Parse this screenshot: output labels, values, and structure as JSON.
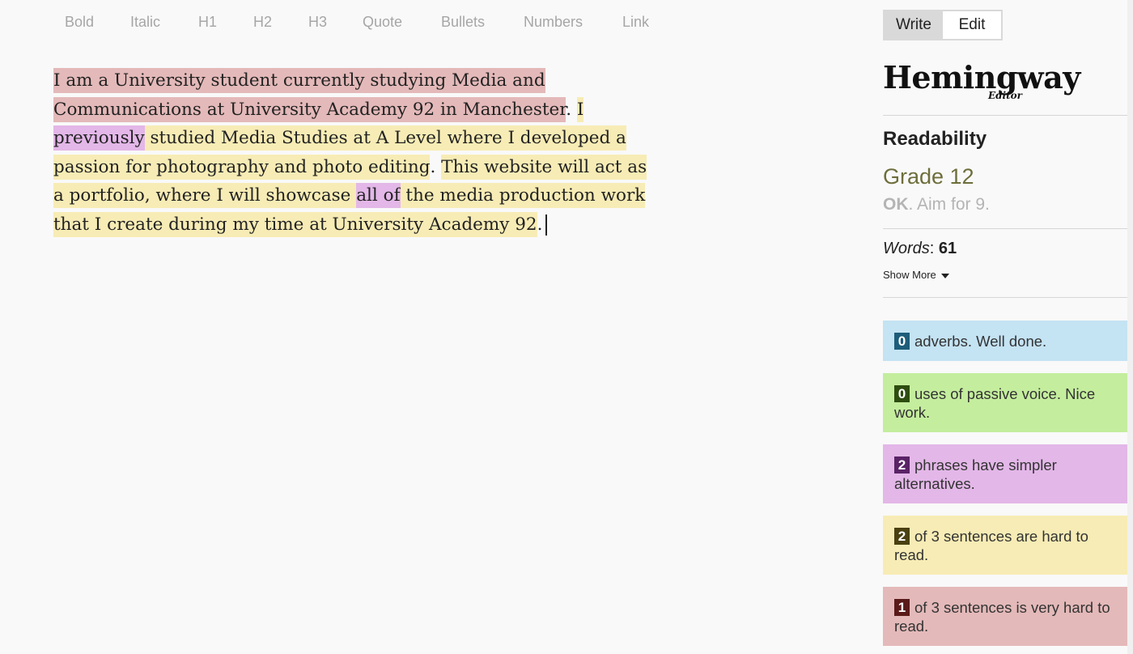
{
  "toolbar": {
    "bold": "Bold",
    "italic": "Italic",
    "h1": "H1",
    "h2": "H2",
    "h3": "H3",
    "quote": "Quote",
    "bullets": "Bullets",
    "numbers": "Numbers",
    "link": "Link"
  },
  "editor": {
    "line1": {
      "vhard": " I am a University student currently studying Media and"
    },
    "line2": {
      "vhard": "Communications at University Academy 92 in Manchester",
      "plain": ". ",
      "hard": "I"
    },
    "line3": {
      "phrase": "previously",
      "hard": " studied Media Studies at A Level where I developed a "
    },
    "line4": {
      "hard1": "passion for photography and photo editing",
      "plain": ". ",
      "hard2": "This website will act as"
    },
    "line5": {
      "hard1": "a portfolio, where I will showcase ",
      "phrase": "all of",
      "hard2": " the media production work"
    },
    "line6": {
      "hard": "that I create during my time at University Academy 92",
      "plain": "."
    }
  },
  "mode": {
    "write": "Write",
    "edit": "Edit"
  },
  "logo": {
    "main": "Hemingway",
    "sub": "Editor"
  },
  "readability": {
    "title": "Readability",
    "grade": "Grade 12",
    "status": "OK",
    "aim": ". Aim for 9."
  },
  "stats": {
    "words_label": "Words",
    "words_sep": ": ",
    "words_value": "61",
    "show_more": "Show More"
  },
  "cards": {
    "adverbs": {
      "count": "0",
      "text": "adverbs. Well done."
    },
    "passive": {
      "count": "0",
      "text": "uses of passive voice. Nice work."
    },
    "phrases": {
      "count": "2",
      "text": "phrases have simpler alternatives."
    },
    "hard": {
      "count": "2",
      "text": "of 3 sentences are hard to read."
    },
    "very_hard": {
      "count": "1",
      "text": "of 3 sentences is very hard to read."
    }
  },
  "colors": {
    "very_hard": "#e4b9b9",
    "hard": "#f7ecb5",
    "phrase": "#e3b7e8",
    "adverb": "#c4e3f3",
    "passive": "#c4ed9d"
  }
}
